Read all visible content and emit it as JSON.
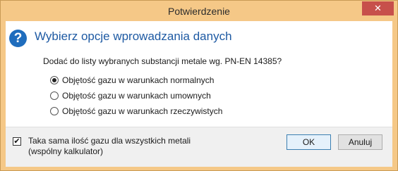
{
  "window": {
    "title": "Potwierdzenie",
    "close_glyph": "✕"
  },
  "header": {
    "icon": "question-icon",
    "icon_glyph": "?",
    "title": "Wybierz opcje wprowadzania danych"
  },
  "question": "Dodać do listy wybranych substancji metale wg. PN-EN 14385?",
  "options": [
    {
      "label": "Objętość gazu w warunkach normalnych",
      "selected": true
    },
    {
      "label": "Objętość gazu w warunkach umownych",
      "selected": false
    },
    {
      "label": "Objętość gazu w warunkach rzeczywistych",
      "selected": false
    }
  ],
  "checkbox": {
    "checked": true,
    "check_glyph": "✔",
    "label_line1": "Taka sama ilość gazu dla wszystkich metali",
    "label_line2": "(wspólny kalkulator)"
  },
  "buttons": {
    "ok": "OK",
    "cancel": "Anuluj"
  },
  "colors": {
    "titlebar": "#f5c887",
    "close_button": "#c7504b",
    "header_title": "#1e5aa3",
    "question_icon": "#1f6dbd"
  }
}
